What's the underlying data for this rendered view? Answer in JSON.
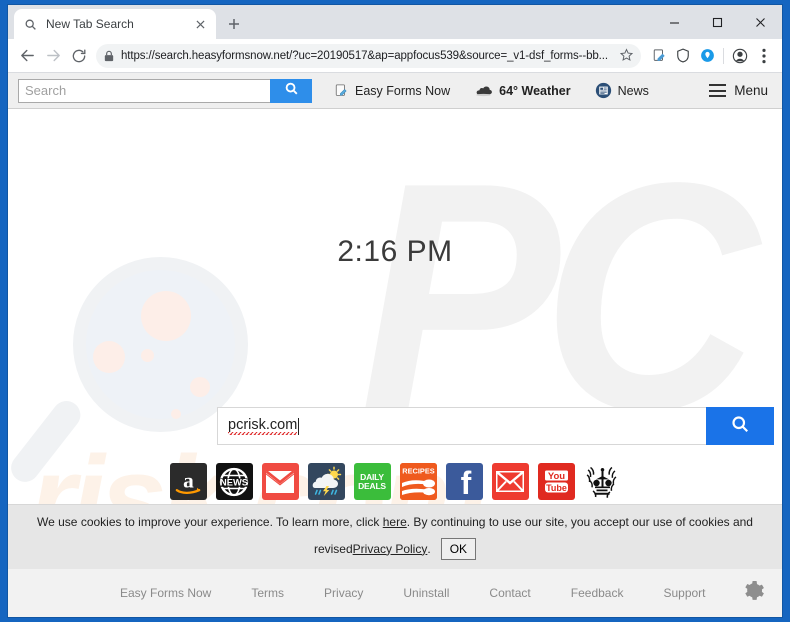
{
  "browser": {
    "tab": {
      "title": "New Tab Search",
      "favicon_icon": "search-icon",
      "close_icon": "close-icon"
    },
    "newtab_icon": "plus-icon",
    "window_controls": {
      "minimize": "–",
      "maximize": "☐",
      "close": "✕"
    },
    "nav": {
      "back_icon": "arrow-left-icon",
      "forward_icon": "arrow-right-icon",
      "reload_icon": "reload-icon"
    },
    "omnibox": {
      "lock_icon": "lock-icon",
      "url": "https://search.heasyformsnow.net/?uc=20190517&ap=appfocus539&source=_v1-dsf_forms--bb...",
      "bookmark_icon": "star-icon"
    },
    "omnibox_icons": [
      "edit-document-icon",
      "shield-icon",
      "location-pin-icon",
      "profile-avatar-icon",
      "kebab-menu-icon"
    ]
  },
  "hijacker_toolbar": {
    "search": {
      "placeholder": "Search",
      "value": "",
      "button_icon": "search-icon"
    },
    "links": [
      {
        "label": "Easy Forms Now",
        "icon": "form-document-icon"
      },
      {
        "label": "64° Weather",
        "icon": "cloud-icon"
      },
      {
        "label": "News",
        "icon": "newspaper-icon"
      }
    ],
    "menu": {
      "label": "Menu",
      "icon": "hamburger-icon"
    }
  },
  "page": {
    "clock": "2:16 PM",
    "watermark_top": "PC",
    "watermark_bottom": "risk.com",
    "search": {
      "value": "pcrisk.com",
      "placeholder": "",
      "button_icon": "search-icon"
    },
    "quick_icons": [
      {
        "name": "amazon",
        "label": "a",
        "bg": "#2b2b2b",
        "fg": "#ffffff"
      },
      {
        "name": "news",
        "label": "NEWS",
        "bg": "#111111",
        "fg": "#ffffff"
      },
      {
        "name": "gmail",
        "label": "",
        "bg": "#f04b42",
        "fg": "#ffffff"
      },
      {
        "name": "weather",
        "label": "",
        "bg": "#33475e",
        "fg": "#ffffff"
      },
      {
        "name": "daily-deals",
        "label": "DAILY DEALS",
        "bg": "#3bbd3b",
        "fg": "#ffffff"
      },
      {
        "name": "recipes",
        "label": "RECIPES",
        "bg": "#ef5a1e",
        "fg": "#ffffff"
      },
      {
        "name": "facebook",
        "label": "f",
        "bg": "#3b5a9b",
        "fg": "#ffffff"
      },
      {
        "name": "mail",
        "label": "",
        "bg": "#ee3b30",
        "fg": "#ffffff"
      },
      {
        "name": "youtube",
        "label": "You Tube",
        "bg": "#e02a20",
        "fg": "#ffffff"
      },
      {
        "name": "irs",
        "label": "",
        "bg": "#ffffff",
        "fg": "#000000"
      }
    ]
  },
  "cookie_bar": {
    "text_before_here": "We use cookies to improve your experience. To learn more, click ",
    "here_link": "here",
    "text_after_here": ". By continuing to use our site, you accept our use of cookies and",
    "revised_text": "revised ",
    "privacy_link": "Privacy Policy",
    "period": ".",
    "ok_label": "OK"
  },
  "footer": {
    "links": [
      "Easy Forms Now",
      "Terms",
      "Privacy",
      "Uninstall",
      "Contact",
      "Feedback",
      "Support"
    ],
    "settings_icon": "gear-icon"
  },
  "colors": {
    "desktop": "#1565c0",
    "accent_blue": "#1a73e8",
    "toolbar_blue": "#2e8eea",
    "tabstrip": "#dee1e6",
    "cookie_bg": "#e6e6e6",
    "footer_bg": "#f2f2f2"
  }
}
